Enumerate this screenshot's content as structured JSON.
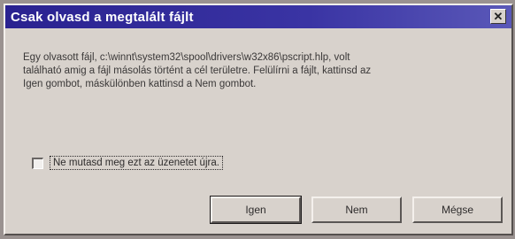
{
  "dialog": {
    "title": "Csak olvasd a megtalált fájlt",
    "close_glyph": "✕",
    "message_lines": [
      "Egy olvasott fájl, c:\\winnt\\system32\\spool\\drivers\\w32x86\\pscript.hlp, volt",
      "található amig a fájl másolás történt a cél területre. Felülírni a fájlt, kattinsd az",
      "Igen gombot, máskülönben kattinsd a Nem gombot."
    ],
    "checkbox": {
      "label": "Ne mutasd meg ezt az üzenetet újra.",
      "checked": false
    },
    "buttons": {
      "yes_label": "Igen",
      "no_label": "Nem",
      "cancel_label": "Mégse"
    }
  },
  "colors": {
    "titlebar": "#2a2290",
    "dialog_face": "#d8d2cc",
    "title_text": "#ffffff"
  },
  "icons": {
    "close": "close-icon"
  }
}
